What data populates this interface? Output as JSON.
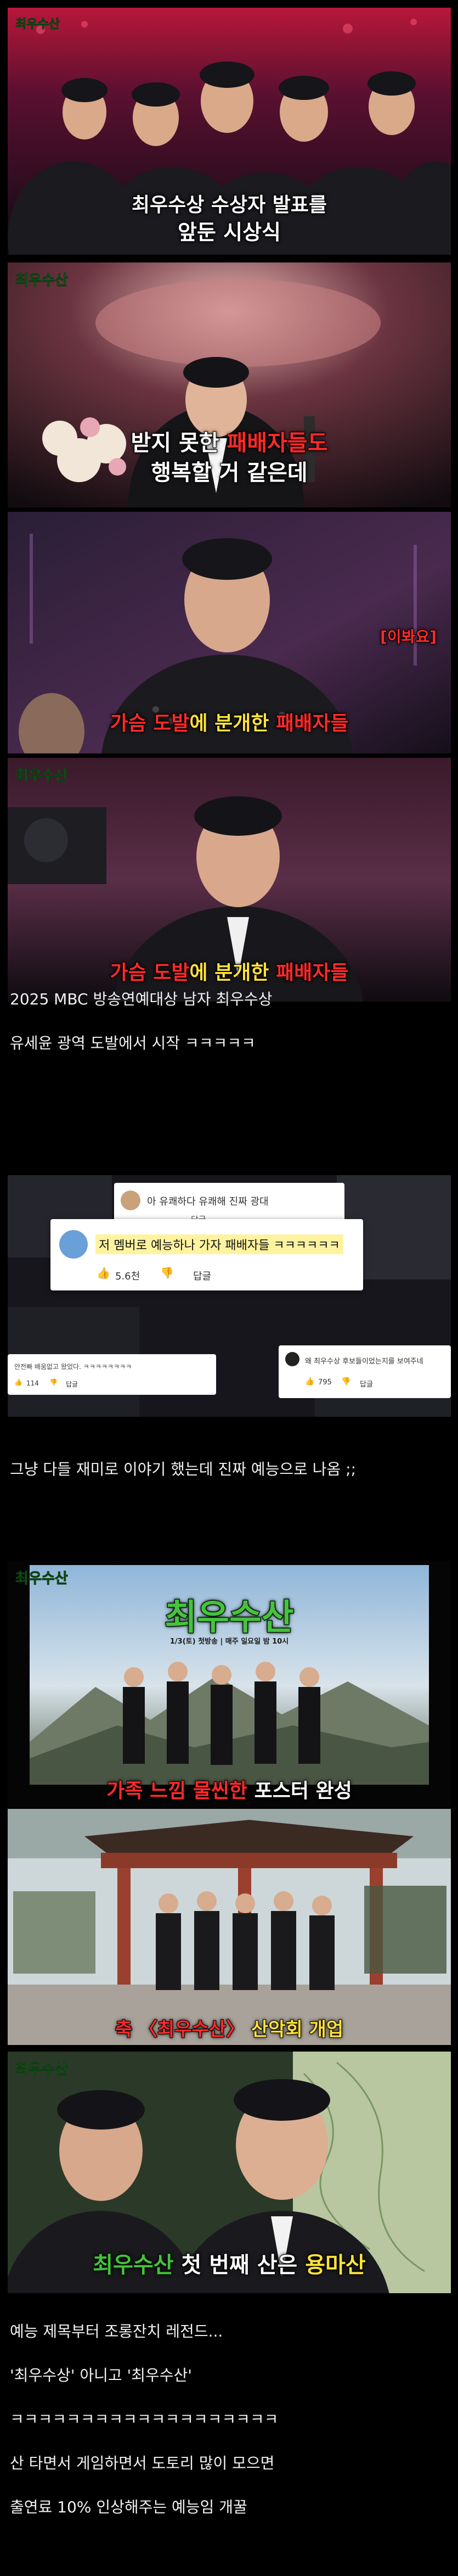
{
  "scene1": {
    "logo": "최우수산",
    "caption_line1": "최우수상 수상자 발표를",
    "caption_line2": "앞둔 시상식"
  },
  "scene2": {
    "logo": "최우수산",
    "caption_line1_pre": "받지 못한 ",
    "caption_line1_hl": "패배자들도",
    "caption_line2": "행복할 거 같은데"
  },
  "scene3": {
    "tag": "[이봐요]",
    "caption_pre": "가슴 도발",
    "caption_mid": "에 분개한 ",
    "caption_hl": "패배자들"
  },
  "scene4": {
    "logo": "최우수산",
    "caption_pre": "가슴 도발",
    "caption_mid": "에 분개한 ",
    "caption_hl": "패배자들"
  },
  "text1": {
    "line1": "2025 MBC 방송연예대상 남자 최우수상",
    "line2": "유세윤 광역 도발에서 시작 ㅋㅋㅋㅋㅋ"
  },
  "comments": {
    "c1_text": "아 유쾌하다 유쾌해 진짜 광대",
    "c1_reply": "답글",
    "c2_text": "저 멤버로 예능하나 가자 패배자들 ㅋㅋㅋㅋㅋㅋ",
    "c2_likes": "5.6천",
    "c2_reply": "답글",
    "c3_text": "안전빠 배움없고 왔었다. ㅋㅋㅋㅋㅋㅋㅋㅋ",
    "c3_likes": "114",
    "c3_reply": "답글",
    "c4_text": "왜 최우수상 후보들이었는지를 보여주네",
    "c4_likes": "795",
    "c4_reply": "답글"
  },
  "text2": {
    "line1": "그냥 다들 재미로 이야기 했는데 진짜 예능으로 나옴 ;;"
  },
  "scene5": {
    "logo": "최우수산",
    "title": "최우수산",
    "poster_sub": "1/3(토) 첫방송 | 매주 일요일 밤 10시",
    "caption_pre": "가족 느낌 물씬한 ",
    "caption_hl": "포스터 완성"
  },
  "scene6": {
    "caption_pre": "축 〈최우수산〉 ",
    "caption_hl": "산악회 개업"
  },
  "scene7": {
    "logo": "최우수산",
    "caption_logo": "최우수산",
    "caption_mid": " 첫 번째 산은 ",
    "caption_hl": "용마산"
  },
  "text3": {
    "line1": "예능 제목부터 조롱잔치 레전드...",
    "line2": "'최우수상' 아니고 '최우수산'",
    "line3": "ㅋㅋㅋㅋㅋㅋㅋㅋㅋㅋㅋㅋㅋㅋㅋㅋㅋㅋㅋ",
    "line4": "산 타면서 게임하면서 도토리 많이 모으면",
    "line5": "출연료 10% 인상해주는 예능임 개꿀"
  },
  "colors": {
    "caption_white": "#ffffff",
    "caption_red": "#ff2a2a",
    "caption_yellow": "#ffe23a",
    "logo_green": "#46c23c",
    "highlight_yellow": "#fff3a0"
  }
}
